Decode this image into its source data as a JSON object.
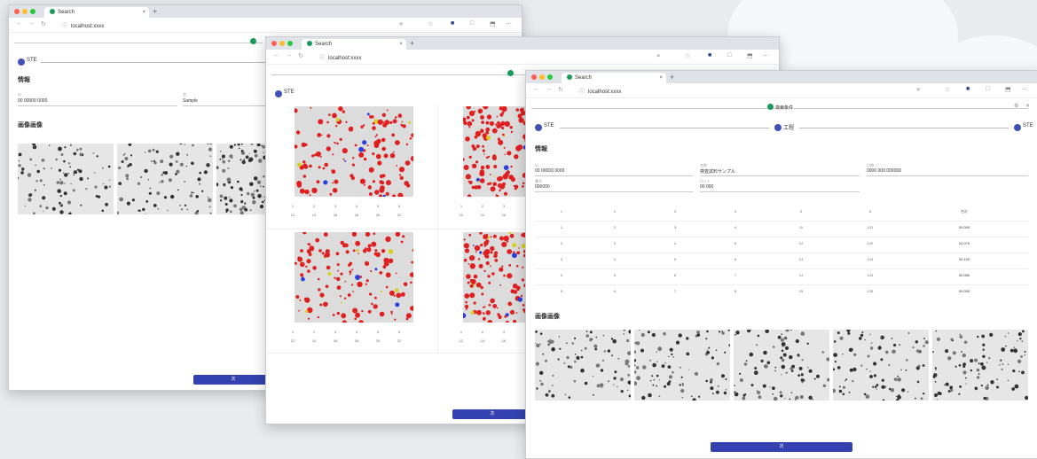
{
  "browser": {
    "tab_title": "Search",
    "url": "localhost:xxxx",
    "new_tab_symbol": "+",
    "tab_close_symbol": "×"
  },
  "window_left": {
    "steps": [
      "STE"
    ],
    "section1": "情報",
    "fields": [
      {
        "label": "ID",
        "value": "00 00000 0000"
      },
      {
        "label": "名",
        "value": "Sample"
      }
    ],
    "section2": "画像画像",
    "button_label": "次"
  },
  "window_middle": {
    "steps": [
      "STE"
    ],
    "button_label": "次",
    "thumb_table_row1": [
      "1",
      "2",
      "3",
      "4",
      "5",
      "6"
    ],
    "thumb_table_row2": [
      "12",
      "14",
      "16",
      "18",
      "20",
      "22"
    ]
  },
  "window_right": {
    "steps": [
      "STE",
      "工程",
      "STE"
    ],
    "search_chip": "検索条件",
    "section1": "情報",
    "fields": [
      {
        "label": "ID",
        "value": "00 00000 0000"
      },
      {
        "label": "名称",
        "value": "検査試料サンプル"
      },
      {
        "label": "日時",
        "value": "0000 000 000000"
      },
      {
        "label": "番号",
        "value": "000000"
      },
      {
        "label": "ロット",
        "value": "00 000"
      }
    ],
    "table": {
      "headers": [
        "1",
        "2",
        "3",
        "4",
        "5",
        "6",
        "合計"
      ],
      "rows": [
        [
          "1",
          "2",
          "3",
          "4",
          "11",
          "121",
          "00.000"
        ],
        [
          "2",
          "3",
          "4",
          "5",
          "12",
          "122",
          "00.070"
        ],
        [
          "3",
          "4",
          "5",
          "6",
          "13",
          "123",
          "00.100"
        ],
        [
          "4",
          "5",
          "6",
          "7",
          "14",
          "124",
          "00.080"
        ],
        [
          "5",
          "6",
          "7",
          "8",
          "15",
          "125",
          "00.050"
        ]
      ]
    },
    "section2": "画像画像",
    "button_label": "次"
  }
}
